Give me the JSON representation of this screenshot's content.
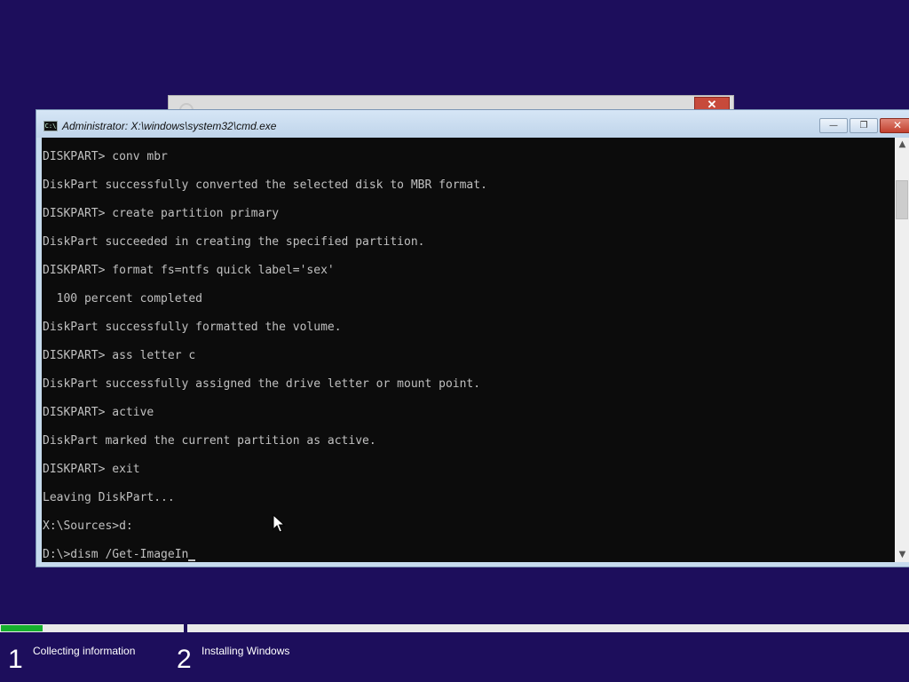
{
  "background_window": {
    "close_glyph": "✕"
  },
  "cmd_window": {
    "icon_text": "C:\\",
    "title": "Administrator: X:\\windows\\system32\\cmd.exe",
    "minimize_glyph": "—",
    "maximize_glyph": "❐",
    "close_glyph": "✕"
  },
  "console": {
    "lines": [
      "DISKPART> conv mbr",
      "",
      "DiskPart successfully converted the selected disk to MBR format.",
      "",
      "DISKPART> create partition primary",
      "",
      "DiskPart succeeded in creating the specified partition.",
      "",
      "DISKPART> format fs=ntfs quick label='sex'",
      "",
      "  100 percent completed",
      "",
      "DiskPart successfully formatted the volume.",
      "",
      "DISKPART> ass letter c",
      "",
      "DiskPart successfully assigned the drive letter or mount point.",
      "",
      "DISKPART> active",
      "",
      "DiskPart marked the current partition as active.",
      "",
      "DISKPART> exit",
      "",
      "Leaving DiskPart...",
      "",
      "X:\\Sources>d:",
      "",
      "D:\\>dism /Get-ImageIn"
    ]
  },
  "scrollbar": {
    "up_glyph": "▲",
    "down_glyph": "▼"
  },
  "setup_progress": {
    "step1_fill_fraction": 0.23,
    "accent_color": "#16b02e",
    "steps": [
      {
        "number": "1",
        "label": "Collecting information"
      },
      {
        "number": "2",
        "label": "Installing Windows"
      }
    ]
  },
  "icons": {
    "console_icon": "console-app-icon",
    "pointer": "mouse-pointer-icon"
  }
}
